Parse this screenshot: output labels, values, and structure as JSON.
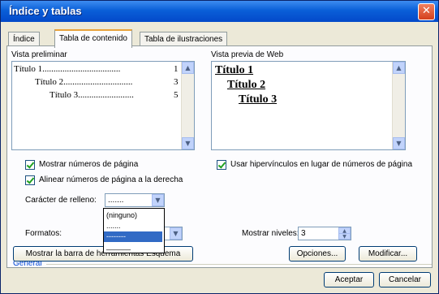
{
  "window": {
    "title": "Índice y tablas",
    "close_glyph": "✕"
  },
  "tabs": [
    {
      "label": "Índice",
      "active": false
    },
    {
      "label": "Tabla de contenido",
      "active": true
    },
    {
      "label": "Tabla de ilustraciones",
      "active": false
    }
  ],
  "print_preview": {
    "label": "Vista preliminar",
    "lines": [
      {
        "text": "Título 1",
        "dots": "...................................",
        "page": "1"
      },
      {
        "text": "Título 2",
        "dots": "...............................",
        "page": "3"
      },
      {
        "text": "Título 3",
        "dots": ".........................",
        "page": "5"
      }
    ]
  },
  "web_preview": {
    "label": "Vista previa de Web",
    "lines": [
      "Título 1",
      "Título 2",
      "Título 3"
    ]
  },
  "options": {
    "show_page_numbers": "Mostrar números de página",
    "align_page_numbers": "Alinear números de página a la derecha",
    "use_hyperlinks": "Usar hipervínculos en lugar de números de página",
    "tab_leader_label": "Carácter de relleno:",
    "tab_leader_value": ".......",
    "tab_leader_options": [
      "(ninguno)",
      ".......",
      "--------",
      "______"
    ]
  },
  "general": {
    "label": "General",
    "formats_label": "Formatos:",
    "show_levels_label": "Mostrar niveles:",
    "show_levels_value": "3"
  },
  "buttons": {
    "outline_toolbar": "Mostrar la barra de herramientas Esquema",
    "options": "Opciones...",
    "modify": "Modificar...",
    "ok": "Aceptar",
    "cancel": "Cancelar"
  },
  "icons": {
    "scroll_up": "▲",
    "scroll_down": "▼",
    "combo_arrow": "▼",
    "spin_up": "▲",
    "spin_down": "▼"
  },
  "colors": {
    "titlebar": "#0a5fd8",
    "active_tab_accent": "#e8a23a",
    "selection": "#316ac5",
    "group_label": "#0046d5"
  }
}
